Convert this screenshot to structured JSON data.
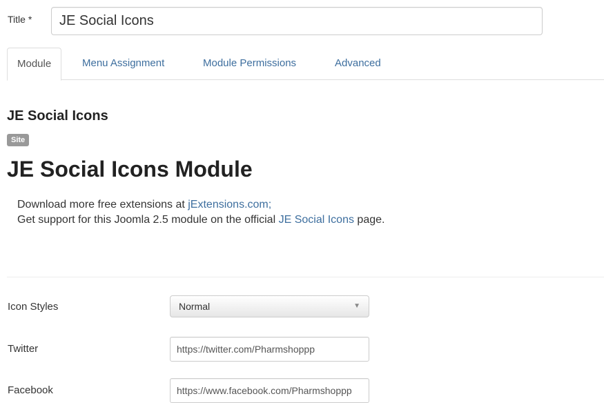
{
  "title_field": {
    "label": "Title *",
    "value": "JE Social Icons"
  },
  "tabs": [
    {
      "label": "Module",
      "active": true
    },
    {
      "label": "Menu Assignment",
      "active": false
    },
    {
      "label": "Module Permissions",
      "active": false
    },
    {
      "label": "Advanced",
      "active": false
    }
  ],
  "module": {
    "name": "JE Social Icons",
    "badge": "Site",
    "heading": "JE Social Icons Module",
    "desc_line1_prefix": "Download more free extensions at ",
    "desc_line1_link": "jExtensions.com;",
    "desc_line2_prefix": "Get support for this Joomla 2.5 module on the official ",
    "desc_line2_link": "JE Social Icons",
    "desc_line2_suffix": " page."
  },
  "fields": {
    "icon_styles": {
      "label": "Icon Styles",
      "value": "Normal"
    },
    "twitter": {
      "label": "Twitter",
      "value": "https://twitter.com/Pharmshoppp"
    },
    "facebook": {
      "label": "Facebook",
      "value": "https://www.facebook.com/Pharmshoppp"
    }
  },
  "colors": {
    "link": "#3d6e9e",
    "badge_bg": "#999999"
  }
}
